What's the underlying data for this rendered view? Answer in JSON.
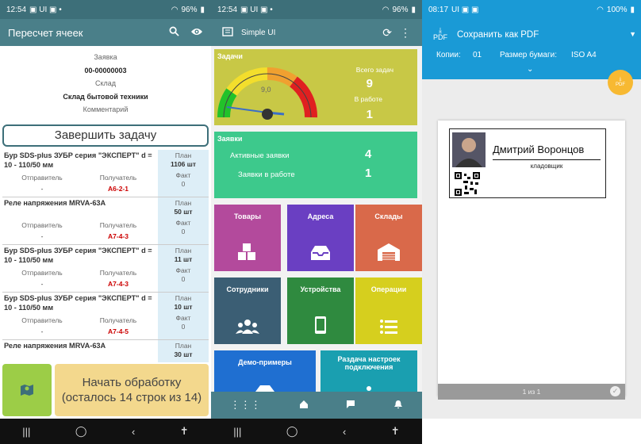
{
  "colors": {
    "teal": "#4a7f89",
    "blue": "#1a9ad6",
    "yellow_tile": "#c8c846",
    "green_tile": "#3dc98c"
  },
  "panel1": {
    "status": {
      "time": "12:54",
      "left_icons": "▣ UI ▣ •",
      "right": "96%"
    },
    "appbar": {
      "title": "Пересчет ячеек",
      "icons": [
        "search-icon",
        "eye-icon"
      ]
    },
    "header": {
      "l1": "Заявка",
      "l2": "00-00000003",
      "l3": "Склад",
      "l4": "Склад бытовой техники",
      "l5": "Комментарий"
    },
    "finish_button": "Завершить задачу",
    "columns": {
      "from": "Отправитель",
      "to": "Получатель",
      "plan": "План",
      "fact": "Факт"
    },
    "rows": [
      {
        "name": "Бур SDS-plus ЗУБР серия \"ЭКСПЕРТ\" d = 10 - 110/50 мм",
        "from": "-",
        "to": "А6-2-1",
        "plan": "1106 шт",
        "fact": "0"
      },
      {
        "name": "Реле напряжения MRVA-63A",
        "from": "-",
        "to": "А7-4-3",
        "plan": "50 шт",
        "fact": "0"
      },
      {
        "name": "Бур SDS-plus ЗУБР серия \"ЭКСПЕРТ\" d = 10 - 110/50 мм",
        "from": "-",
        "to": "А7-4-3",
        "plan": "11 шт",
        "fact": "0"
      },
      {
        "name": "Бур SDS-plus ЗУБР серия \"ЭКСПЕРТ\" d = 10 - 110/50 мм",
        "from": "-",
        "to": "А7-4-5",
        "plan": "10 шт",
        "fact": "0"
      },
      {
        "name": "Реле напряжения MRVA-63A",
        "from": "",
        "to": "",
        "plan": "30 шт",
        "fact": ""
      }
    ],
    "start_button": "Начать обработку (осталось 14 строк из 14)"
  },
  "panel2": {
    "status": {
      "time": "12:54",
      "left_icons": "▣ UI ▣ •",
      "right": "96%"
    },
    "appbar": {
      "title": "Simple UI"
    },
    "tasks": {
      "title": "Задачи",
      "gauge_value": "9,0",
      "total_label": "Всего задач",
      "total": "9",
      "inwork_label": "В работе",
      "inwork": "1"
    },
    "orders": {
      "title": "Заявки",
      "active_label": "Активные заявки",
      "active": "4",
      "inwork_label": "Заявки в работе",
      "inwork": "1"
    },
    "tiles": [
      {
        "label": "Товары",
        "color": "#b34a9c",
        "icon": "boxes-icon"
      },
      {
        "label": "Адреса",
        "color": "#6a3fc2",
        "icon": "inbox-icon"
      },
      {
        "label": "Склады",
        "color": "#d9694a",
        "icon": "warehouse-icon"
      },
      {
        "label": "Сотрудники",
        "color": "#3b5e74",
        "icon": "people-icon"
      },
      {
        "label": "Устройства",
        "color": "#2f8a3f",
        "icon": "phone-icon"
      },
      {
        "label": "Операции",
        "color": "#d6cf1e",
        "icon": "list-icon"
      },
      {
        "label": "Демо-примеры",
        "color": "#1f6fd1",
        "icon": "demo-icon"
      },
      {
        "label": "Раздача настроек подключения",
        "color": "#1a9fb0",
        "icon": "share-icon"
      }
    ]
  },
  "panel3": {
    "status": {
      "time": "08:17",
      "left_icons": "UI ▣ ▣",
      "right": "100%"
    },
    "save": "Сохранить как PDF",
    "pdf_icon_label": "PDF",
    "copies_label": "Копии:",
    "copies": "01",
    "paper_label": "Размер бумаги:",
    "paper": "ISO A4",
    "card": {
      "name": "Дмитрий Воронцов",
      "role": "кладовщик"
    },
    "pager": "1 из 1"
  }
}
